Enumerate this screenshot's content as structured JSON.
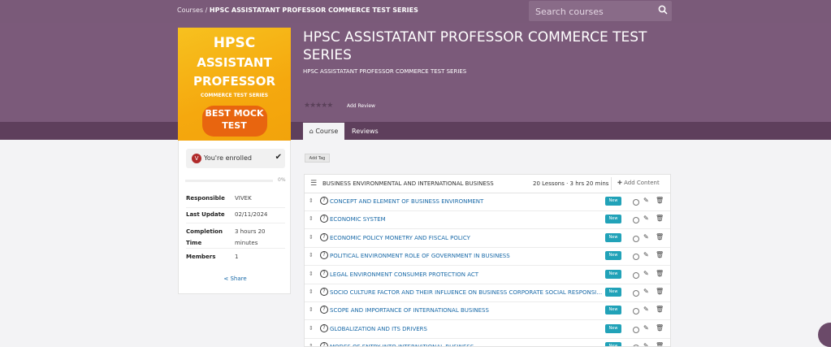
{
  "breadcrumb": {
    "root": "Courses",
    "sep": "/",
    "current": "HPSC ASSISTATANT PROFESSOR COMMERCE TEST SERIES"
  },
  "search": {
    "placeholder": "Search courses",
    "icon": "search-icon"
  },
  "cover": {
    "line1": "HPSC",
    "line2": "ASSISTANT",
    "line3": "PROFESSOR",
    "line4": "COMMERCE TEST SERIES",
    "line5": "BEST MOCK",
    "line6": "TEST"
  },
  "course": {
    "title": "HPSC ASSISTATANT PROFESSOR COMMERCE TEST SERIES",
    "subtitle": "HPSC ASSISTATANT PROFESSOR COMMERCE TEST SERIES",
    "stars": "★★★★★",
    "add_review": "Add Review"
  },
  "tabs": {
    "course": "Course",
    "reviews": "Reviews"
  },
  "sidebar": {
    "avatar_letter": "V",
    "enrolled": "You're enrolled",
    "progress_value": 0,
    "progress_label": "0%",
    "info": [
      {
        "k": "Responsible",
        "v": "VIVEK"
      },
      {
        "k": "Last Update",
        "v": "02/11/2024"
      },
      {
        "k": "Completion Time",
        "v": "3 hours 20 minutes"
      },
      {
        "k": "Members",
        "v": "1"
      }
    ],
    "share": "Share"
  },
  "add_tag": "Add Tag",
  "section": {
    "name": "BUSINESS ENVIRONMENTAL AND INTERNATIONAL BUSINESS",
    "meta": "20 Lessons · 3 hrs 20 mins",
    "add_content": "Add Content",
    "new_label": "New",
    "lessons": [
      "CONCEPT AND ELEMENT OF BUSINESS ENVIRONMENT",
      "ECONOMIC SYSTEM",
      "ECONOMIC POLICY MONETRY AND FISCAL POLICY",
      "POLITICAL ENVIRONMENT ROLE OF GOVERNMENT IN BUSINESS",
      "LEGAL ENVIRONMENT CONSUMER PROTECTION ACT",
      "SOCIO CULTURE FACTOR AND THEIR INFLUENCE ON BUSINESS CORPORATE SOCIAL RESPONSIBILITY",
      "SCOPE AND IMPORTANCE OF INTERNATIONAL BUSINESS",
      "GLOBALIZATION AND ITS DRIVERS",
      "MODES OF ENTRY INTO INTERNATIONAL BUSINESS"
    ]
  }
}
